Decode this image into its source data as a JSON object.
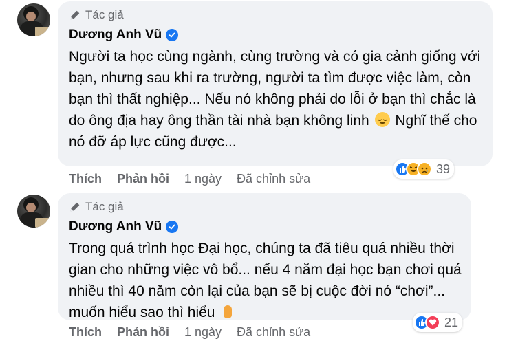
{
  "comments": [
    {
      "author_badge": "Tác giả",
      "author_name": "Dương Anh Vũ",
      "text_before_emoji": "Người ta học cùng ngành, cùng trường và có gia cảnh giống với bạn, nhưng sau khi ra trường, người ta tìm được việc làm, còn bạn thì thất nghiệp... Nếu nó không phải do lỗi ở bạn thì chắc là do ông địa hay ông thần tài nhà bạn không linh",
      "emoji": "relieved-face-icon",
      "text_after_emoji": " Nghĩ thế cho nó đỡ áp lực cũng được...",
      "reactions": [
        "like",
        "haha",
        "sad"
      ],
      "reaction_count": "39",
      "actions": {
        "like": "Thích",
        "reply": "Phản hồi",
        "time": "1 ngày",
        "edited": "Đã chỉnh sửa"
      }
    },
    {
      "author_badge": "Tác giả",
      "author_name": "Dương Anh Vũ",
      "text_before_emoji": "Trong quá trình học Đại học, chúng ta đã tiêu quá nhiều thời gian cho những việc vô bổ... nếu 4 năm đại học bạn chơi quá nhiều thì 40 năm còn lại của bạn sẽ bị cuộc đời nó “chơi”... muốn hiểu sao thì hiểu",
      "emoji": "crossed-fingers-icon",
      "text_after_emoji": "",
      "reactions": [
        "like",
        "love"
      ],
      "reaction_count": "21",
      "actions": {
        "like": "Thích",
        "reply": "Phản hồi",
        "time": "1 ngày",
        "edited": "Đã chỉnh sửa"
      }
    }
  ],
  "colors": {
    "bubble": "#f0f2f5",
    "secondary_text": "#65676b",
    "verified": "#1877f2",
    "like": "#1877f2",
    "love": "#f33e58",
    "haha": "#f7b125"
  }
}
